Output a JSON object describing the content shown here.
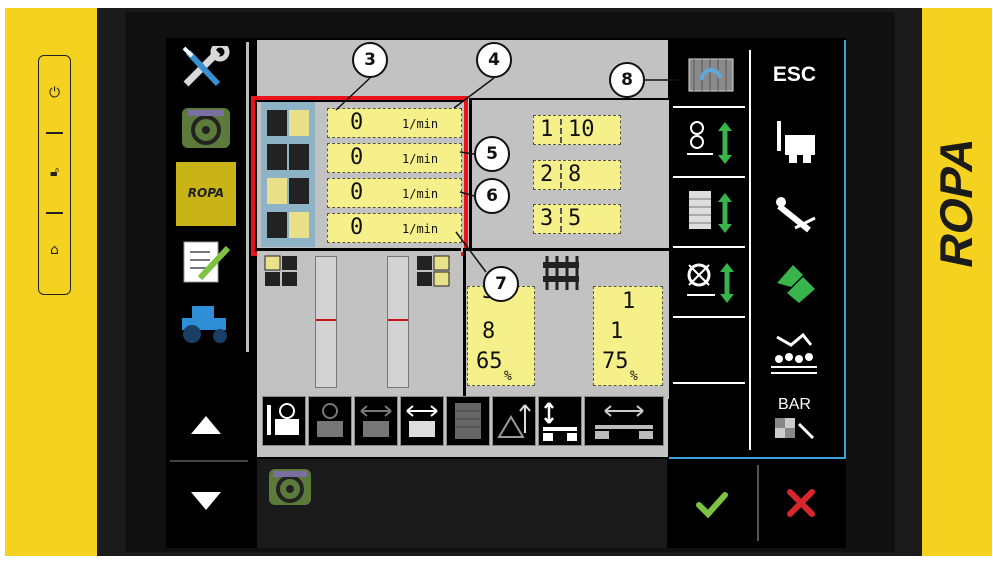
{
  "left_buttons": {
    "power_icon": "power-icon",
    "lock_icon": "unlock-icon",
    "home_icon": "home-icon"
  },
  "brand": {
    "logo_text": "ROPA"
  },
  "sidebar": {
    "items": [
      {
        "icon": "wrench-screwdriver-icon"
      },
      {
        "icon": "steering-wheel-icon"
      },
      {
        "icon": "ropa-logo",
        "label": "ROPA"
      },
      {
        "icon": "checklist-icon"
      },
      {
        "icon": "tractor-icon"
      }
    ],
    "up_icon": "arrow-up-icon",
    "down_icon": "arrow-down-icon"
  },
  "speeds": {
    "unit": "1/min",
    "rows": [
      {
        "value": "0",
        "unit": "1/min"
      },
      {
        "value": "0",
        "unit": "1/min"
      },
      {
        "value": "0",
        "unit": "1/min"
      },
      {
        "value": "0",
        "unit": "1/min"
      }
    ]
  },
  "ratios": [
    {
      "a": "1",
      "b": "10"
    },
    {
      "a": "2",
      "b": "8"
    },
    {
      "a": "3",
      "b": "5"
    }
  ],
  "left_values": {
    "top": "3",
    "mid": "8",
    "pct": "65",
    "pct_unit": "%"
  },
  "right_values": {
    "top": "1",
    "mid": "1",
    "pct": "75",
    "pct_unit": "%"
  },
  "callouts": [
    "3",
    "4",
    "5",
    "6",
    "7",
    "8"
  ],
  "right_panel": {
    "esc_label": "ESC",
    "bar_label": "BAR"
  },
  "colors": {
    "accent_yellow": "#f5d21f",
    "field_yellow": "#f5f08a",
    "highlight_red": "#e8141a",
    "confirm_green": "#7dc242",
    "cancel_red": "#d8262d",
    "frame_blue": "#3aa0d8"
  }
}
